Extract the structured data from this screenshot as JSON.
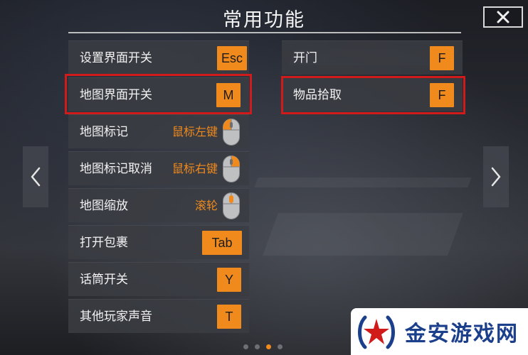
{
  "title": "常用功能",
  "colors": {
    "accent": "#f08a1d",
    "highlight": "#d11a1a",
    "panel": "#3a3c42"
  },
  "left_column": [
    {
      "label": "设置界面开关",
      "type": "key",
      "key": "Esc",
      "highlighted": false
    },
    {
      "label": "地图界面开关",
      "type": "key",
      "key": "M",
      "highlighted": true
    },
    {
      "label": "地图标记",
      "type": "mouse",
      "binding": "鼠标左键",
      "mouse_part": "left"
    },
    {
      "label": "地图标记取消",
      "type": "mouse",
      "binding": "鼠标右键",
      "mouse_part": "right"
    },
    {
      "label": "地图缩放",
      "type": "mouse",
      "binding": "滚轮",
      "mouse_part": "wheel"
    },
    {
      "label": "打开包裹",
      "type": "key",
      "key": "Tab",
      "highlighted": false
    },
    {
      "label": "话筒开关",
      "type": "key",
      "key": "Y",
      "highlighted": false
    },
    {
      "label": "其他玩家声音",
      "type": "key",
      "key": "T",
      "highlighted": false
    }
  ],
  "right_column": [
    {
      "label": "开门",
      "type": "key",
      "key": "F",
      "highlighted": false
    },
    {
      "label": "物品拾取",
      "type": "key",
      "key": "F",
      "highlighted": true
    }
  ],
  "pagination": {
    "total": 4,
    "current": 3
  },
  "icons": {
    "close": "close-icon",
    "prev": "chevron-left-icon",
    "next": "chevron-right-icon",
    "mouse": "mouse-icon"
  },
  "watermark": {
    "text": "金安游戏网"
  }
}
